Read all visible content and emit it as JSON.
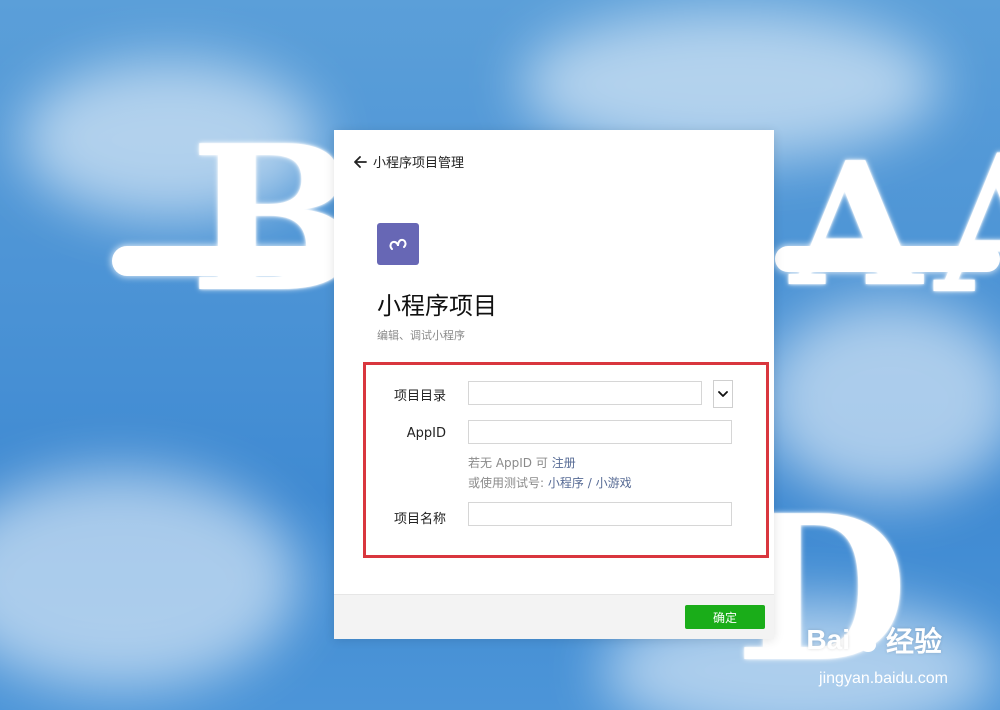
{
  "background_letters": {
    "left": "B",
    "right_a": "A",
    "right_edge": "A",
    "bottom": "D"
  },
  "dialog": {
    "back_label": "小程序项目管理",
    "title": "小程序项目",
    "subtitle": "编辑、调试小程序",
    "form": {
      "dir_label": "项目目录",
      "dir_value": "",
      "appid_label": "AppID",
      "appid_value": "",
      "hint_line1_prefix": "若无 AppID 可",
      "hint_register": "注册",
      "hint_line2_prefix": "或使用测试号:",
      "hint_miniprogram": "小程序",
      "hint_separator": "/",
      "hint_minigame": "小游戏",
      "name_label": "项目名称",
      "name_value": ""
    },
    "ok_label": "确定"
  },
  "watermark": {
    "brand_left": "Bai",
    "brand_right": "经验",
    "url": "jingyan.baidu.com"
  },
  "colors": {
    "accent_green": "#1aad19",
    "highlight_red": "#d9363e",
    "logo_purple": "#6767b5",
    "link_blue": "#576b95"
  }
}
